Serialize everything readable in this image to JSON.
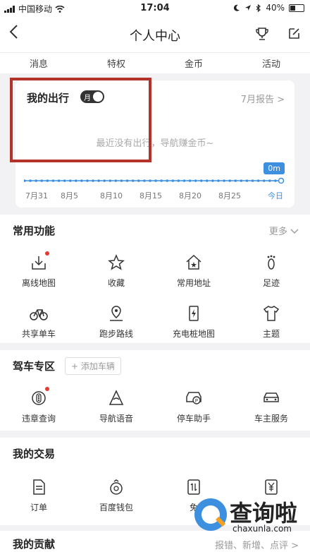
{
  "status_bar": {
    "carrier": "中国移动",
    "time": "17:04",
    "battery_pct": "40%",
    "battery_fraction": 0.4
  },
  "nav": {
    "title": "个人中心"
  },
  "tabs": [
    "消息",
    "特权",
    "金币",
    "活动"
  ],
  "trip": {
    "title": "我的出行",
    "toggle_label": "月",
    "report_link": "7月报告 >",
    "empty_message": "最近没有出行，导航赚金币~",
    "distance": "0m",
    "dates": [
      "7月31",
      "8月5",
      "8月10",
      "8月15",
      "8月20",
      "8月25",
      "今日"
    ]
  },
  "common": {
    "title": "常用功能",
    "more": "更多",
    "items": [
      {
        "label": "离线地图",
        "icon": "download-map-icon",
        "dot": true
      },
      {
        "label": "收藏",
        "icon": "star-icon",
        "dot": false
      },
      {
        "label": "常用地址",
        "icon": "home-star-icon",
        "dot": false
      },
      {
        "label": "足迹",
        "icon": "footprint-icon",
        "dot": false
      },
      {
        "label": "共享单车",
        "icon": "bike-icon",
        "dot": false
      },
      {
        "label": "跑步路线",
        "icon": "run-route-icon",
        "dot": false
      },
      {
        "label": "充电桩地图",
        "icon": "charging-icon",
        "dot": false
      },
      {
        "label": "主题",
        "icon": "shirt-icon",
        "dot": false
      }
    ]
  },
  "drive": {
    "title": "驾车专区",
    "add_car": "+ 添加车辆",
    "items": [
      {
        "label": "违章查询",
        "icon": "violation-icon",
        "dot": true
      },
      {
        "label": "导航语音",
        "icon": "voice-icon",
        "dot": false
      },
      {
        "label": "停车助手",
        "icon": "parking-icon",
        "dot": false
      },
      {
        "label": "车主服务",
        "icon": "car-icon",
        "dot": false
      }
    ]
  },
  "trade": {
    "title": "我的交易",
    "items": [
      {
        "label": "订单",
        "icon": "order-icon"
      },
      {
        "label": "百度钱包",
        "icon": "wallet-icon"
      },
      {
        "label": "免",
        "icon": "exchange-icon"
      },
      {
        "label": "",
        "icon": "yen-icon"
      }
    ]
  },
  "contrib": {
    "title": "我的贡献",
    "link": "报错、新增、点评 >"
  },
  "watermark": {
    "cn": "查询啦",
    "en": "chaxunla.com"
  },
  "colors": {
    "accent": "#3d8fe0",
    "highlight": "#b3322a",
    "dot": "#e23c2f"
  }
}
